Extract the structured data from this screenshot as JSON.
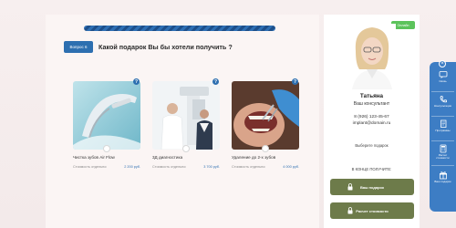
{
  "quiz": {
    "question_badge": "Вопрос 6",
    "question_text": "Какой подарок Вы бы хотели получить ?",
    "progress_percent": 100
  },
  "cards": [
    {
      "name": "Чистка зубов Air Flow",
      "price_label": "Стоимость отдельно:",
      "price": "2 200 руб.",
      "help": "?"
    },
    {
      "name": "3Д диагностика",
      "price_label": "Стоимость отдельно:",
      "price": "3 700 руб.",
      "help": "?"
    },
    {
      "name": "Удаление до 2-х зубов",
      "price_label": "Стоимость отдельно:",
      "price": "4 000 руб.",
      "help": "?"
    }
  ],
  "sidebar": {
    "status": "Онлайн",
    "name": "Татьяна",
    "role": "Ваш консультант",
    "phone": "8 (926) 123-45-67",
    "email": "implant@domain.ru",
    "choose_hint": "Выберите подарок",
    "end_title": "В КОНЦЕ ПОЛУЧИТЕ:",
    "buttons": [
      "Ваш подарок",
      "Расчет стоимости"
    ]
  },
  "rail": {
    "close": "×",
    "items": [
      {
        "label_lines": [
          "Связь",
          ""
        ],
        "icon": "chat-icon"
      },
      {
        "label_lines": [
          "Консультация",
          ""
        ],
        "icon": "phone-icon"
      },
      {
        "label_lines": [
          "Программы",
          ""
        ],
        "icon": "document-icon"
      },
      {
        "label_lines": [
          "Расчет",
          "стоимости"
        ],
        "icon": "calculator-icon"
      },
      {
        "label_lines": [
          "Ваш подарок",
          ""
        ],
        "icon": "gift-icon"
      }
    ]
  },
  "colors": {
    "accent_blue": "#2d6fb0",
    "online_green": "#5cc35b",
    "button_olive": "#6d7b4a",
    "rail_blue": "#3d7dc4"
  }
}
